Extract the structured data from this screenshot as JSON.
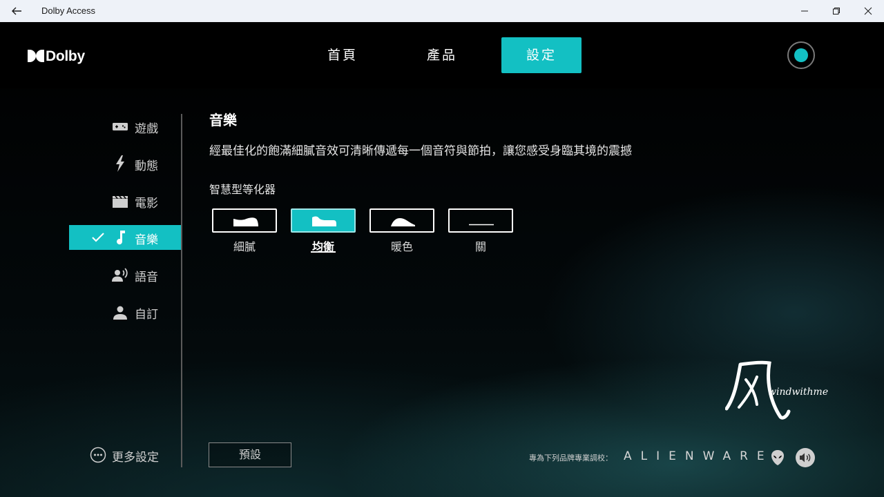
{
  "window": {
    "title": "Dolby Access",
    "back_icon": "back-arrow-icon",
    "minimize_icon": "minimize-icon",
    "restore_icon": "restore-icon",
    "close_icon": "close-icon"
  },
  "header": {
    "brand": "Dolby",
    "tabs": [
      {
        "label": "首頁",
        "active": false
      },
      {
        "label": "產品",
        "active": false
      },
      {
        "label": "設定",
        "active": true
      }
    ],
    "accent_color": "#13c0c3"
  },
  "sidebar": {
    "items": [
      {
        "label": "遊戲",
        "icon": "gamepad-icon",
        "active": false
      },
      {
        "label": "動態",
        "icon": "lightning-icon",
        "active": false
      },
      {
        "label": "電影",
        "icon": "clapperboard-icon",
        "active": false
      },
      {
        "label": "音樂",
        "icon": "music-note-icon",
        "active": true
      },
      {
        "label": "語音",
        "icon": "voice-icon",
        "active": false
      },
      {
        "label": "自訂",
        "icon": "person-icon",
        "active": false
      }
    ],
    "more_settings": "更多設定"
  },
  "content": {
    "title": "音樂",
    "description": "經最佳化的飽滿細膩音效可清晰傳遞每一個音符與節拍，讓您感受身臨其境的震撼",
    "equalizer_label": "智慧型等化器",
    "equalizer_options": [
      {
        "label": "細膩",
        "active": false
      },
      {
        "label": "均衡",
        "active": true
      },
      {
        "label": "暖色",
        "active": false
      },
      {
        "label": "關",
        "active": false
      }
    ],
    "preset_button": "預設"
  },
  "footer": {
    "tuned_for": "專為下列品牌專業調校：",
    "brand": "ALIENWARE",
    "volume_icon": "speaker-icon"
  },
  "watermark": {
    "text": "windwithme"
  }
}
